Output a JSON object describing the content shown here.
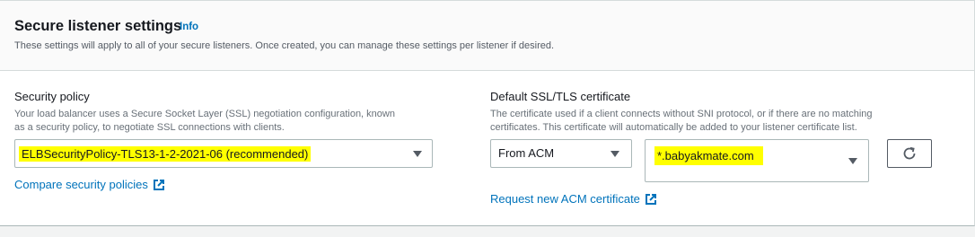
{
  "header": {
    "title": "Secure listener settings",
    "info_label": "Info",
    "description": "These settings will apply to all of your secure listeners. Once created, you can manage these settings per listener if desired."
  },
  "security_policy": {
    "label": "Security policy",
    "hint_line1": "Your load balancer uses a Secure Socket Layer (SSL) negotiation configuration, known",
    "hint_line2": "as a security policy, to negotiate SSL connections with clients.",
    "selected_value": "ELBSecurityPolicy-TLS13-1-2-2021-06 (recommended)",
    "compare_link": "Compare security policies"
  },
  "certificate": {
    "label": "Default SSL/TLS certificate",
    "hint_line1": "The certificate used if a client connects without SNI protocol, or if there are no matching",
    "hint_line2": "certificates. This certificate will automatically be added to your listener certificate list.",
    "source_value": "From ACM",
    "cert_value": "*.babyakmate.com",
    "request_link": "Request new ACM certificate"
  },
  "colors": {
    "link": "#0073bb",
    "highlight": "#ffff00"
  }
}
